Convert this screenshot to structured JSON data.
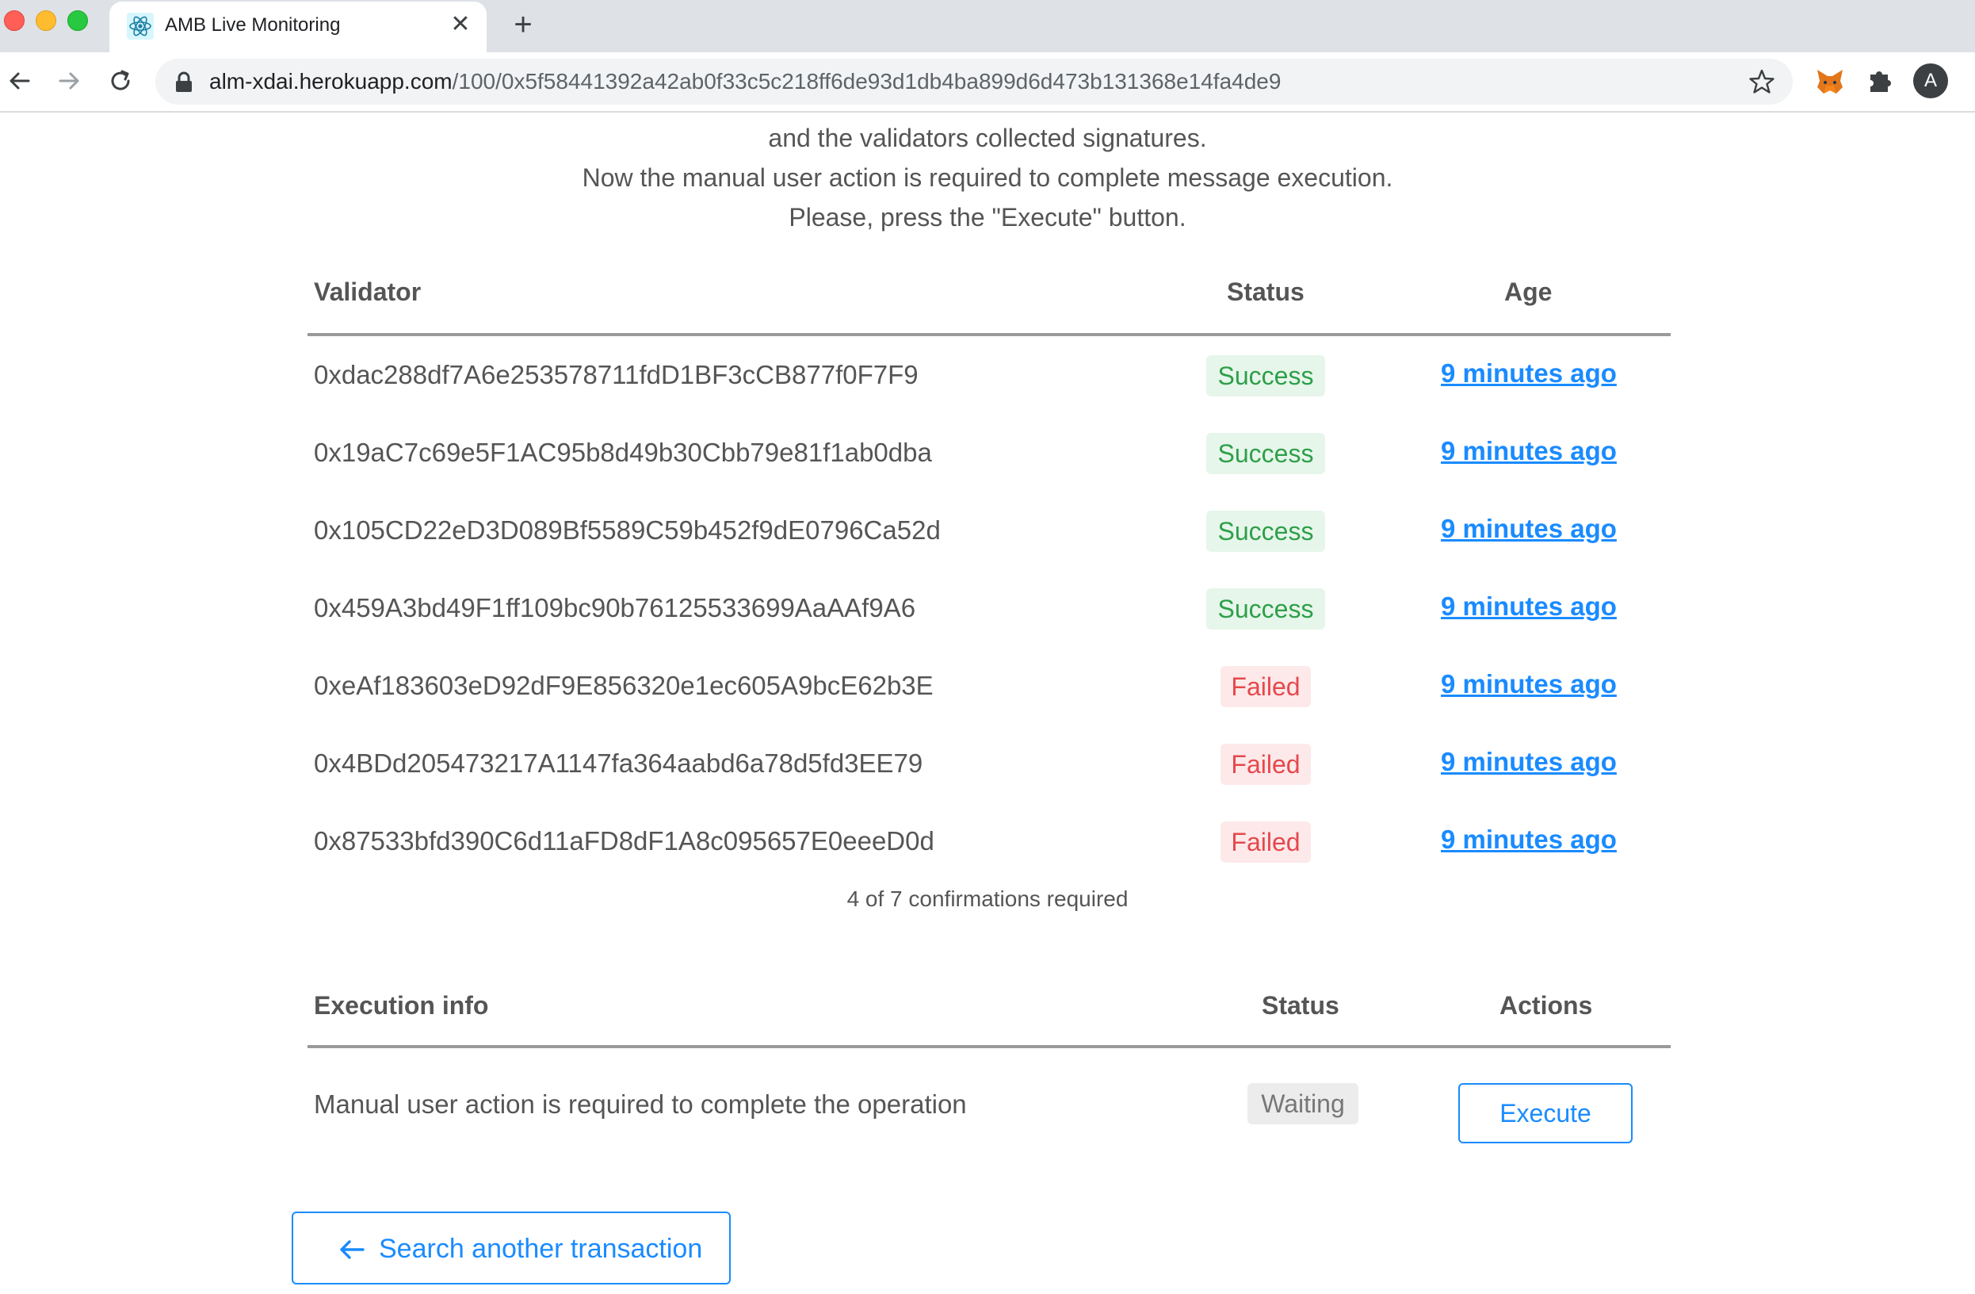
{
  "browser": {
    "tab_title": "AMB Live Monitoring",
    "tab_close": "✕",
    "new_tab": "+",
    "url_host": "alm-xdai.herokuapp.com",
    "url_path": "/100/0x5f58441392a42ab0f33c5c218ff6de93d1db4ba899d6d473b131368e14fa4de9",
    "profile_initial": "A"
  },
  "intro": {
    "line1": "and the validators collected signatures.",
    "line2": "Now the manual user action is required to complete message execution.",
    "line3": "Please, press the \"Execute\" button."
  },
  "validators_table": {
    "headers": {
      "validator": "Validator",
      "status": "Status",
      "age": "Age"
    },
    "rows": [
      {
        "address": "0xdac288df7A6e253578711fdD1BF3cCB877f0F7F9",
        "status": "Success",
        "age": "9 minutes ago"
      },
      {
        "address": "0x19aC7c69e5F1AC95b8d49b30Cbb79e81f1ab0dba",
        "status": "Success",
        "age": "9 minutes ago"
      },
      {
        "address": "0x105CD22eD3D089Bf5589C59b452f9dE0796Ca52d",
        "status": "Success",
        "age": "9 minutes ago"
      },
      {
        "address": "0x459A3bd49F1ff109bc90b76125533699AaAAf9A6",
        "status": "Success",
        "age": "9 minutes ago"
      },
      {
        "address": "0xeAf183603eD92dF9E856320e1ec605A9bcE62b3E",
        "status": "Failed",
        "age": "9 minutes ago"
      },
      {
        "address": "0x4BDd205473217A1147fa364aabd6a78d5fd3EE79",
        "status": "Failed",
        "age": "9 minutes ago"
      },
      {
        "address": "0x87533bfd390C6d11aFD8dF1A8c095657E0eeeD0d",
        "status": "Failed",
        "age": "9 minutes ago"
      }
    ],
    "confirmations": "4 of 7 confirmations required"
  },
  "execution_table": {
    "headers": {
      "info": "Execution info",
      "status": "Status",
      "actions": "Actions"
    },
    "row": {
      "info": "Manual user action is required to complete the operation",
      "status": "Waiting",
      "action_label": "Execute"
    }
  },
  "search_button": {
    "label": "Search another transaction"
  },
  "colors": {
    "accent": "#1a8bff",
    "success_text": "#2e9f4a",
    "success_bg": "#e6f6ea",
    "failed_text": "#e5484d",
    "failed_bg": "#fde9e9",
    "waiting_bg": "#ececec"
  }
}
